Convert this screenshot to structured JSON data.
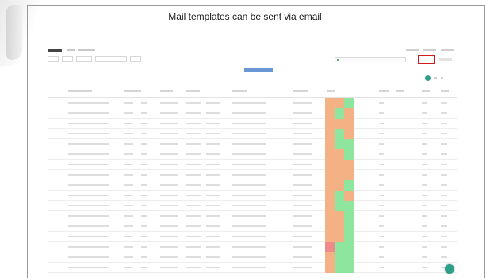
{
  "slide": {
    "title": "Mail templates can be sent via email"
  },
  "colors": {
    "status_green": "#8ee59d",
    "status_orange": "#f4b184",
    "status_red": "#ef8a8a",
    "highlight_border": "#d01c1c",
    "accent_teal": "#2e9f8a",
    "filter_blue": "#6a98d4"
  },
  "table": {
    "row_status": [
      [
        "orange",
        "orange",
        "green"
      ],
      [
        "orange",
        "green",
        "orange"
      ],
      [
        "orange",
        "orange",
        "orange"
      ],
      [
        "orange",
        "green",
        "orange"
      ],
      [
        "orange",
        "green",
        "green"
      ],
      [
        "orange",
        "orange",
        "green"
      ],
      [
        "orange",
        "orange",
        "orange"
      ],
      [
        "orange",
        "orange",
        "orange"
      ],
      [
        "orange",
        "orange",
        "green"
      ],
      [
        "orange",
        "green",
        "orange"
      ],
      [
        "orange",
        "green",
        "green"
      ],
      [
        "orange",
        "orange",
        "green"
      ],
      [
        "orange",
        "orange",
        "green"
      ],
      [
        "orange",
        "orange",
        "green"
      ],
      [
        "red",
        "green",
        "green"
      ],
      [
        "orange",
        "green",
        "green"
      ],
      [
        "orange",
        "green",
        "green"
      ]
    ]
  }
}
